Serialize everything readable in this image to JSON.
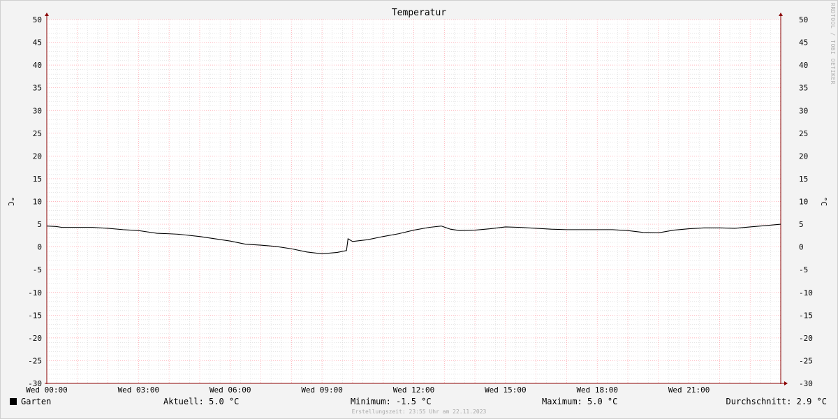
{
  "title": "Temperatur",
  "watermark": "RRDTOOL / TOBI OETIKER",
  "y_unit": "°C",
  "legend": {
    "series_name": "Garten",
    "swatch_color": "#000000"
  },
  "stats": {
    "current": "Aktuell: 5.0 °C",
    "minimum": "Minimum: -1.5 °C",
    "maximum": "Maximum: 5.0 °C",
    "average": "Durchschnitt: 2.9 °C"
  },
  "timestamp": "Erstellungszeit: 23:55 Uhr am 22.11.2023",
  "colors": {
    "major_grid": "#ff9fa8",
    "minor_grid": "#d8d8d8",
    "axis": "#8b0000",
    "line": "#000000",
    "plot_bg": "#ffffff"
  },
  "chart_data": {
    "type": "line",
    "title": "Temperatur",
    "ylabel": "°C",
    "ylim": [
      -30,
      50
    ],
    "y_ticks": [
      "50",
      "45",
      "40",
      "35",
      "30",
      "25",
      "20",
      "15",
      "10",
      "5",
      "0",
      "-5",
      "-10",
      "-15",
      "-20",
      "-25",
      "-30"
    ],
    "x_range_hours": [
      0,
      24
    ],
    "x_ticks": [
      {
        "hour": 0,
        "label": "Wed 00:00"
      },
      {
        "hour": 3,
        "label": "Wed 03:00"
      },
      {
        "hour": 6,
        "label": "Wed 06:00"
      },
      {
        "hour": 9,
        "label": "Wed 09:00"
      },
      {
        "hour": 12,
        "label": "Wed 12:00"
      },
      {
        "hour": 15,
        "label": "Wed 15:00"
      },
      {
        "hour": 18,
        "label": "Wed 18:00"
      },
      {
        "hour": 21,
        "label": "Wed 21:00"
      }
    ],
    "grid": true,
    "series": [
      {
        "name": "Garten",
        "x": [
          0,
          0.3,
          0.5,
          1.0,
          1.5,
          2.0,
          2.5,
          3.0,
          3.3,
          3.6,
          4.0,
          4.3,
          5.0,
          5.5,
          6.0,
          6.5,
          7.0,
          7.5,
          8.0,
          8.5,
          9.0,
          9.5,
          9.8,
          9.85,
          10.0,
          10.5,
          11.0,
          11.5,
          12.0,
          12.5,
          12.9,
          13.2,
          13.5,
          14.0,
          14.5,
          15.0,
          15.5,
          16.0,
          16.5,
          17.0,
          17.5,
          18.0,
          18.5,
          19.0,
          19.5,
          20.0,
          20.5,
          21.0,
          21.5,
          22.0,
          22.5,
          23.0,
          23.5,
          24.0
        ],
        "y": [
          4.6,
          4.5,
          4.3,
          4.3,
          4.3,
          4.1,
          3.8,
          3.6,
          3.3,
          3.0,
          2.9,
          2.8,
          2.3,
          1.8,
          1.3,
          0.6,
          0.4,
          0.1,
          -0.4,
          -1.1,
          -1.5,
          -1.2,
          -0.8,
          1.8,
          1.2,
          1.6,
          2.3,
          2.9,
          3.7,
          4.3,
          4.6,
          3.9,
          3.6,
          3.7,
          4.0,
          4.4,
          4.3,
          4.1,
          3.9,
          3.8,
          3.8,
          3.8,
          3.8,
          3.6,
          3.2,
          3.1,
          3.7,
          4.0,
          4.2,
          4.2,
          4.1,
          4.4,
          4.7,
          5.0
        ]
      }
    ]
  }
}
